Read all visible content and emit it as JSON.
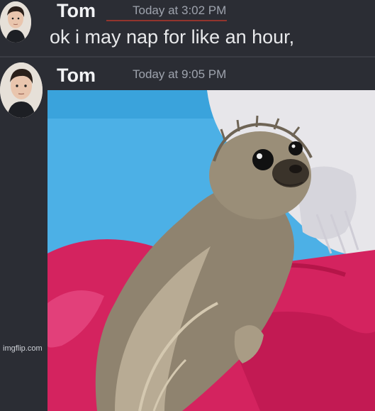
{
  "messages": [
    {
      "username": "Tom",
      "timestamp": "Today at 3:02 PM",
      "text": "ok i may nap for like an hour,"
    },
    {
      "username": "Tom",
      "timestamp": "Today at 9:05 PM",
      "attachment": "photo of a wet seal pup on a pink towel"
    }
  ],
  "watermark": "imgflip.com",
  "colors": {
    "background": "#2b2d34",
    "username": "#f2f3f5",
    "timestamp": "#9ea3ad",
    "pool_blue": "#4cb0e6",
    "towel_pink": "#d4235f"
  }
}
